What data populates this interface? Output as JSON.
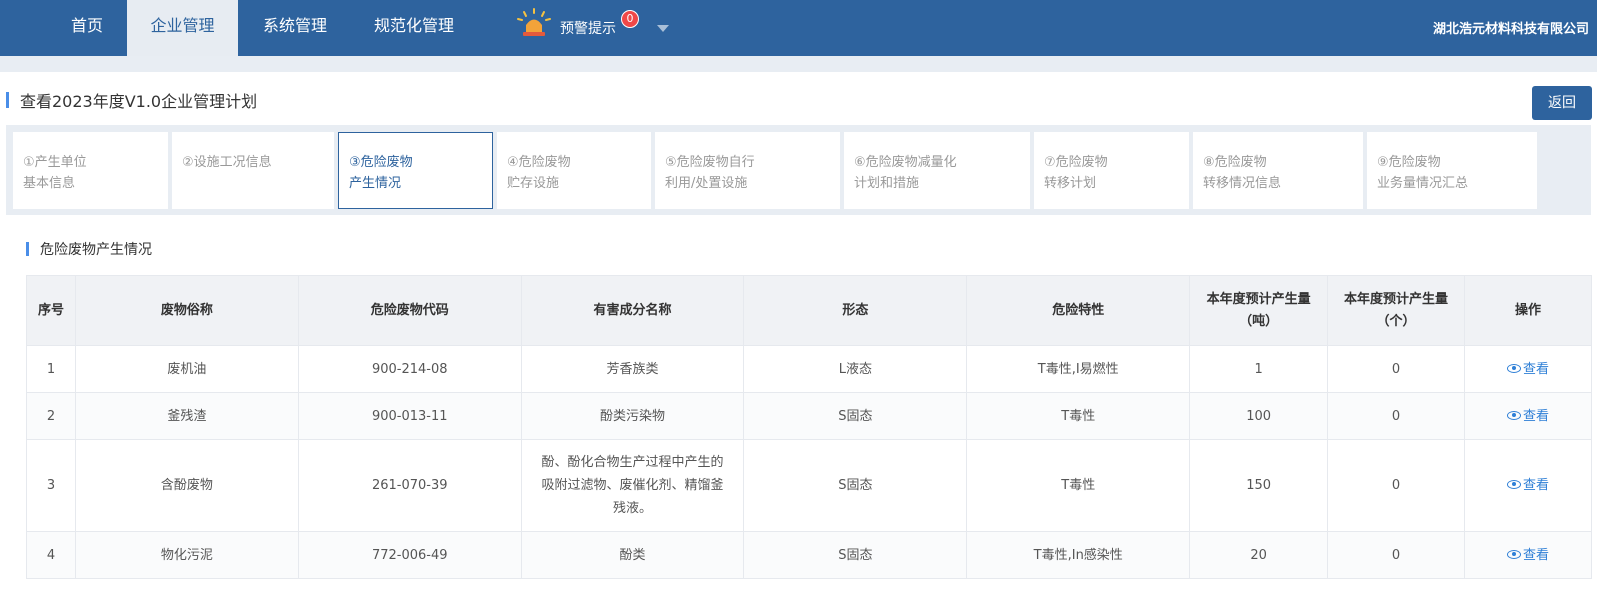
{
  "nav": {
    "items": [
      {
        "label": "首页",
        "active": false
      },
      {
        "label": "企业管理",
        "active": true
      },
      {
        "label": "系统管理",
        "active": false
      },
      {
        "label": "规范化管理",
        "active": false
      }
    ],
    "alarm": {
      "label": "预警提示",
      "count": "0",
      "icon": "siren-icon"
    },
    "company": "湖北浩元材料科技有限公司"
  },
  "page": {
    "title": "查看2023年度V1.0企业管理计划",
    "back_label": "返回"
  },
  "steps": [
    {
      "line1": "①产生单位",
      "line2": "基本信息",
      "active": false
    },
    {
      "line1": "②设施工况信息",
      "line2": "",
      "active": false
    },
    {
      "line1": "③危险废物",
      "line2": "产生情况",
      "active": true
    },
    {
      "line1": "④危险废物",
      "line2": "贮存设施",
      "active": false
    },
    {
      "line1": "⑤危险废物自行",
      "line2": "利用/处置设施",
      "active": false
    },
    {
      "line1": "⑥危险废物减量化",
      "line2": "计划和措施",
      "active": false
    },
    {
      "line1": "⑦危险废物",
      "line2": "转移计划",
      "active": false
    },
    {
      "line1": "⑧危险废物",
      "line2": "转移情况信息",
      "active": false
    },
    {
      "line1": "⑨危险废物",
      "line2": "业务量情况汇总",
      "active": false
    }
  ],
  "section": {
    "title": "危险废物产生情况"
  },
  "table": {
    "headers": [
      "序号",
      "废物俗称",
      "危险废物代码",
      "有害成分名称",
      "形态",
      "危险特性",
      "本年度预计产生量（吨）",
      "本年度预计产生量（个）",
      "操作"
    ],
    "header_lines": [
      [
        "序号"
      ],
      [
        "废物俗称"
      ],
      [
        "危险废物代码"
      ],
      [
        "有害成分名称"
      ],
      [
        "形态"
      ],
      [
        "危险特性"
      ],
      [
        "本年度预计产生量",
        "（吨）"
      ],
      [
        "本年度预计产生量",
        "（个）"
      ],
      [
        "操作"
      ]
    ],
    "rows": [
      {
        "no": "1",
        "name": "废机油",
        "code": "900-214-08",
        "component": [
          "芳香族类"
        ],
        "form": "L液态",
        "hazard": "T毒性,I易燃性",
        "tons": "1",
        "count": "0",
        "action": "查看"
      },
      {
        "no": "2",
        "name": "釜残渣",
        "code": "900-013-11",
        "component": [
          "酚类污染物"
        ],
        "form": "S固态",
        "hazard": "T毒性",
        "tons": "100",
        "count": "0",
        "action": "查看"
      },
      {
        "no": "3",
        "name": "含酚废物",
        "code": "261-070-39",
        "component": [
          "酚、酚化合物生产过程中产生的",
          "吸附过滤物、废催化剂、精馏釜",
          "残液。"
        ],
        "form": "S固态",
        "hazard": "T毒性",
        "tons": "150",
        "count": "0",
        "action": "查看"
      },
      {
        "no": "4",
        "name": "物化污泥",
        "code": "772-006-49",
        "component": [
          "酚类"
        ],
        "form": "S固态",
        "hazard": "T毒性,In感染性",
        "tons": "20",
        "count": "0",
        "action": "查看"
      }
    ]
  },
  "colors": {
    "nav_bg": "#2e639e",
    "accent": "#4a8ee8",
    "link": "#2e7fd6",
    "badge": "#f04848"
  }
}
